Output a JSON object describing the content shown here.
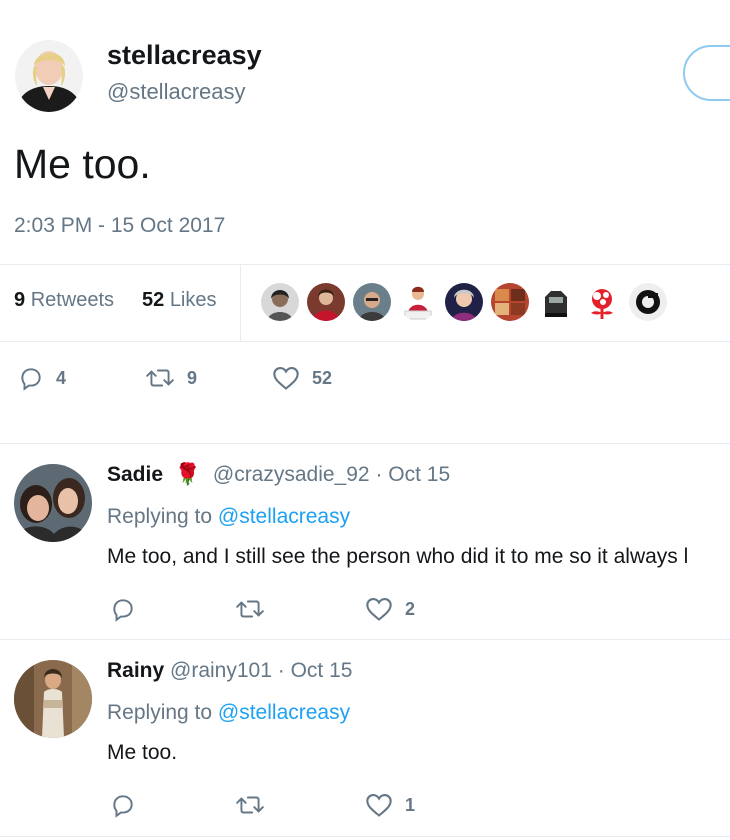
{
  "tweet": {
    "display_name": "stellacreasy",
    "handle": "@stellacreasy",
    "text": "Me too.",
    "timestamp": "2:03 PM - 15 Oct 2017",
    "retweets_count": "9",
    "retweets_label": "Retweets",
    "likes_count": "52",
    "likes_label": "Likes",
    "reply_count": "4",
    "retweet_count_action": "9",
    "like_count_action": "52"
  },
  "replies": [
    {
      "display_name": "Sadie",
      "emoji": "🌹",
      "handle_time": "@crazysadie_92 · Oct 15",
      "replying_label": "Replying to",
      "replying_to": "@stellacreasy",
      "text": "Me too, and I still see the person who did it to me so it always l",
      "likes": "2"
    },
    {
      "display_name": "Rainy",
      "handle_time": "@rainy101 · Oct 15",
      "replying_label": "Replying to",
      "replying_to": "@stellacreasy",
      "text": "Me too.",
      "likes": "1"
    }
  ],
  "icons": {
    "reply": "reply-icon",
    "retweet": "retweet-icon",
    "like": "heart-icon"
  },
  "colors": {
    "accent": "#1da1f2",
    "muted": "#657786",
    "divider": "#e6ecf0"
  }
}
